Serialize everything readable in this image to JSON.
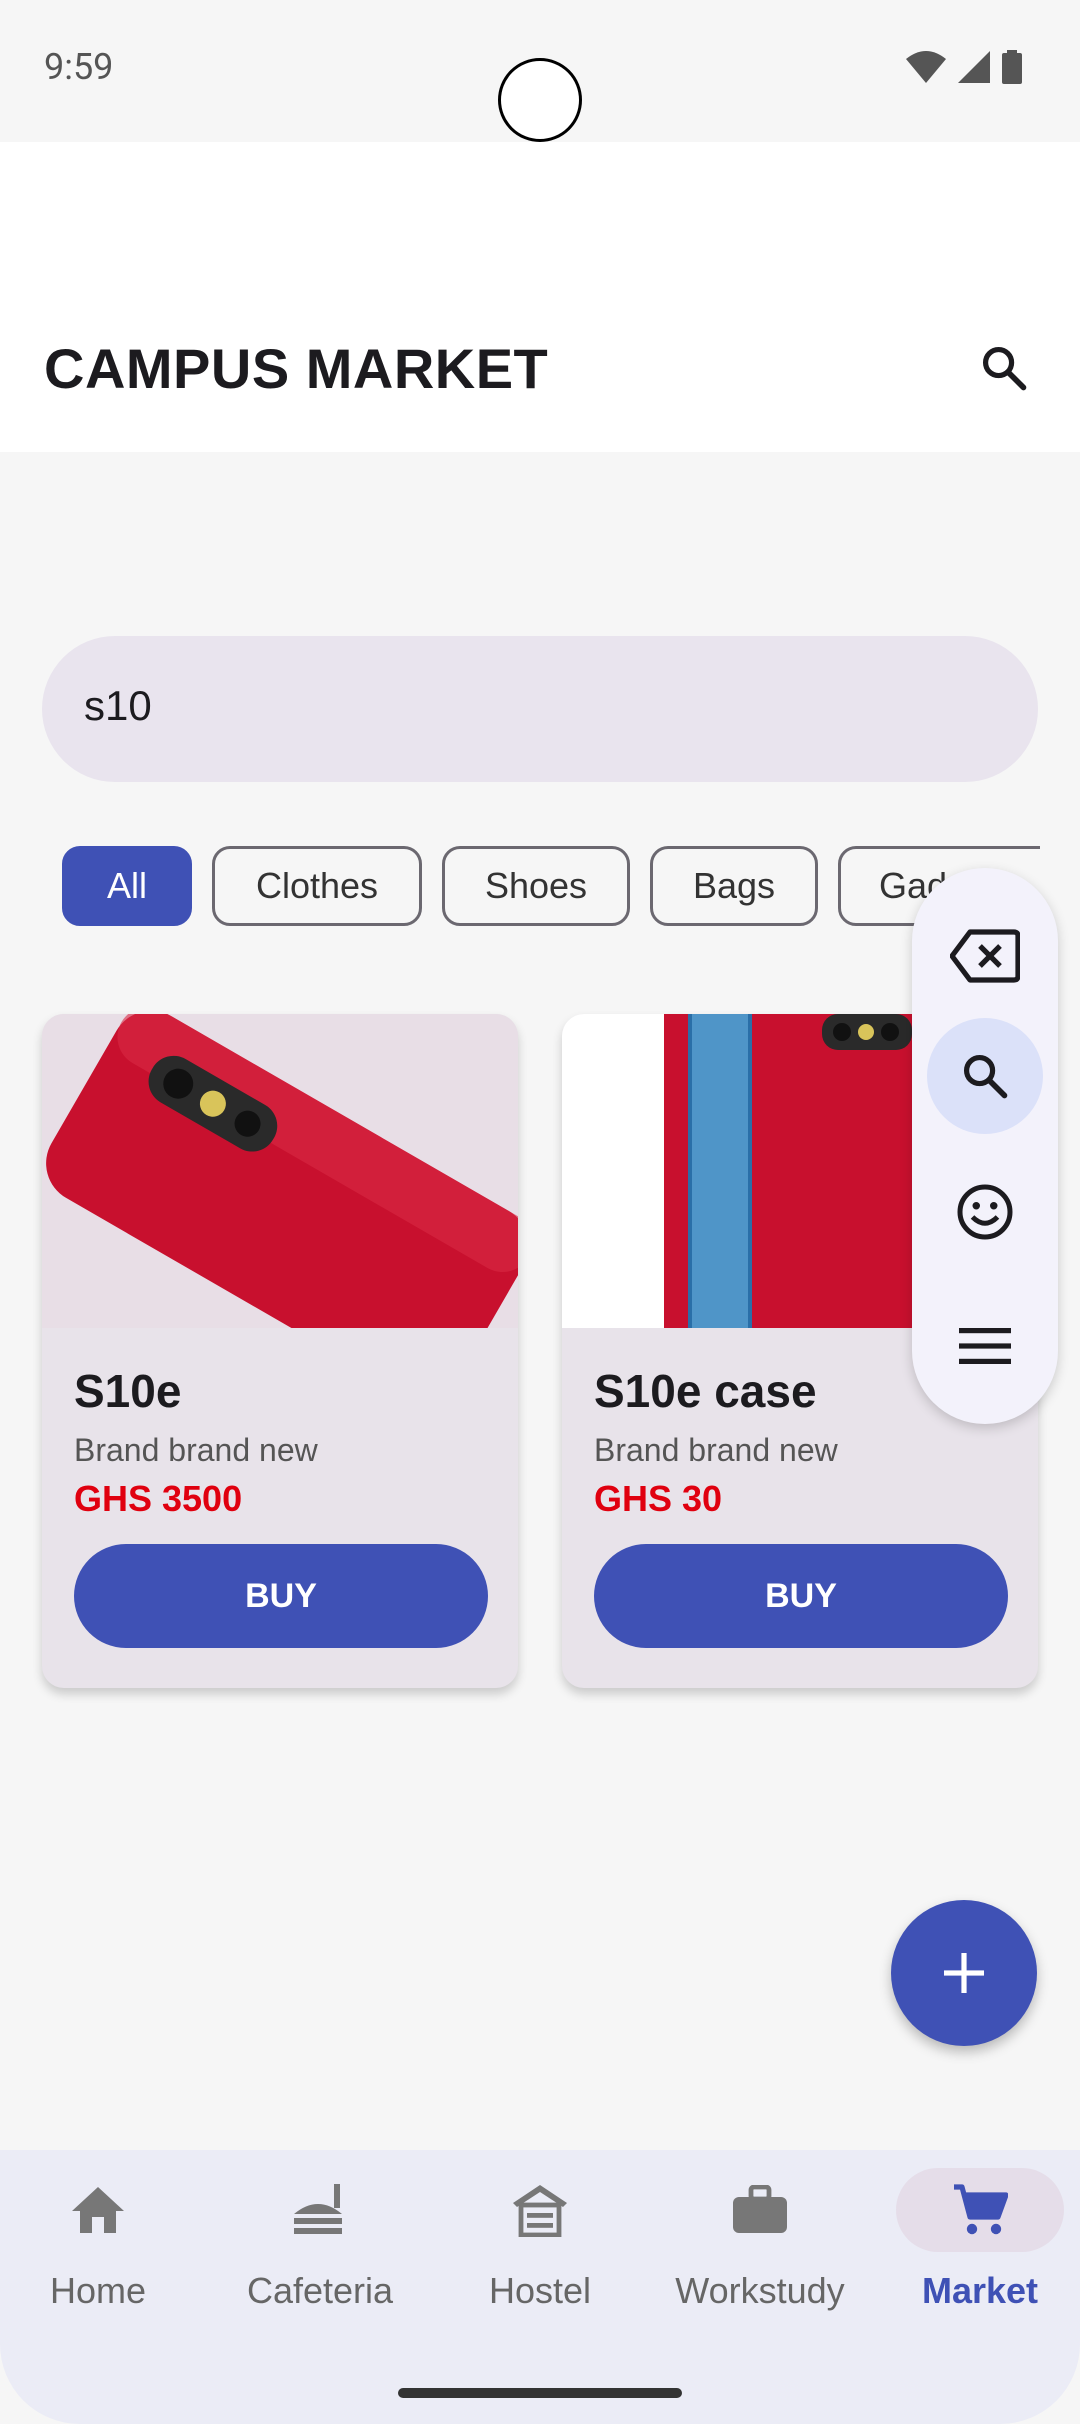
{
  "status_bar": {
    "time": "9:59",
    "icons": [
      "wifi-icon",
      "signal-icon",
      "battery-icon"
    ]
  },
  "app_bar": {
    "title": "CAMPUS MARKET",
    "search_icon": "search-icon"
  },
  "search": {
    "value": "s10"
  },
  "categories": [
    {
      "label": "All",
      "selected": true
    },
    {
      "label": "Clothes",
      "selected": false
    },
    {
      "label": "Shoes",
      "selected": false
    },
    {
      "label": "Bags",
      "selected": false
    },
    {
      "label": "Gadgets",
      "selected": false
    }
  ],
  "products": [
    {
      "title": "S10e",
      "subtitle": "Brand brand new",
      "price": "GHS 3500",
      "button": "BUY"
    },
    {
      "title": "S10e case",
      "subtitle": "Brand brand new",
      "price": "GHS 30",
      "button": "BUY"
    }
  ],
  "floating_toolbar": {
    "items": [
      "backspace-icon",
      "search-icon",
      "emoji-icon",
      "menu-icon"
    ],
    "selected": "search-icon"
  },
  "fab": {
    "icon": "add-icon"
  },
  "bottom_nav": {
    "items": [
      {
        "label": "Home",
        "icon": "home-icon",
        "active": false
      },
      {
        "label": "Cafeteria",
        "icon": "cafeteria-icon",
        "active": false
      },
      {
        "label": "Hostel",
        "icon": "hostel-icon",
        "active": false
      },
      {
        "label": "Workstudy",
        "icon": "briefcase-icon",
        "active": false
      },
      {
        "label": "Market",
        "icon": "cart-icon",
        "active": true
      }
    ]
  },
  "colors": {
    "primary": "#3f51b5",
    "price": "#e0000f",
    "card": "#e8e3ea",
    "search_bg": "#e9e4ee"
  }
}
